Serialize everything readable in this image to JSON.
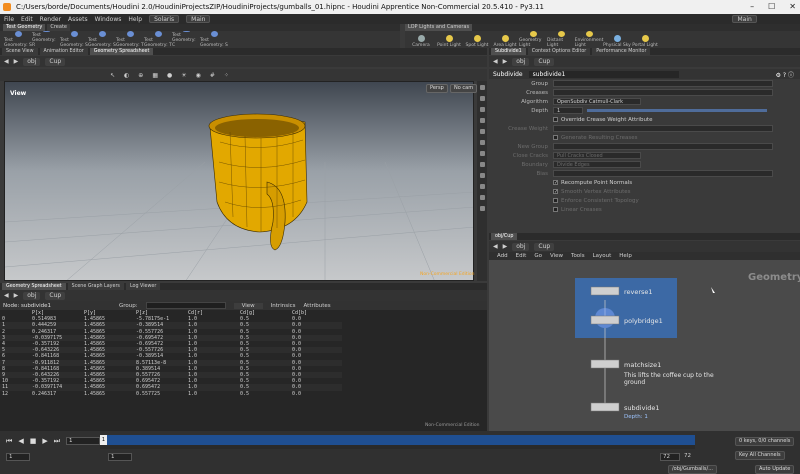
{
  "window": {
    "title": "C:/Users/borde/Documents/Houdini 2.0/HoudiniProjectsZIP/HoudiniProjects/gumballs_01.hipnc - Houdini Apprentice Non-Commercial 20.5.410 - Py3.11"
  },
  "menubar": {
    "items": [
      "File",
      "Edit",
      "Render",
      "Assets",
      "Windows",
      "Help"
    ],
    "desktop": "Solaris",
    "workspace": "Main",
    "right_workspace": "Main"
  },
  "shelf": {
    "tabs": [
      "Test Geometry",
      "Create"
    ],
    "tools": [
      "Test Geometry: S",
      "Test Geometry: R",
      "Test Geometry: S",
      "Test Geometry: S",
      "Test Geometry: T",
      "Test Geometry: T",
      "Test Geometry: C",
      "Test Geometry: S"
    ],
    "right_tab": "LOP Lights and Cameras",
    "right_tools": [
      "Camera",
      "Point Light",
      "Spot Light",
      "Area Light",
      "Geometry Light",
      "Distant Light",
      "Environment Light",
      "Physical Sky",
      "Portal Light"
    ]
  },
  "left_tabs": [
    "Scene View",
    "Animation Editor",
    "Geometry Spreadsheet"
  ],
  "right_tabs": [
    "Subdivide1",
    "Context Options Editor",
    "Performance Monitor"
  ],
  "viewer": {
    "path_root": "obj",
    "path_node": "Cup",
    "label": "View",
    "persp": "Persp",
    "cam": "No cam",
    "watermark": "Non-Commercial Edition"
  },
  "params": {
    "node_type": "Subdivide",
    "node_name": "subdivide1",
    "path_root": "obj",
    "path_node": "Cup",
    "rows": [
      {
        "label": "Group",
        "value": "",
        "dim": false
      },
      {
        "label": "Creases",
        "value": "",
        "dim": false
      },
      {
        "label": "Algorithm",
        "value": "OpenSubdiv Catmull-Clark",
        "dim": false
      },
      {
        "label": "Depth",
        "value": "1",
        "dim": false
      }
    ],
    "checks": [
      {
        "label": "Override Crease Weight Attribute",
        "dim": false
      },
      {
        "label": "Crease Weight",
        "dim": true
      },
      {
        "label": "Generate Resulting Creases",
        "dim": true
      },
      {
        "label": "New Group",
        "dim": true
      },
      {
        "label": "Close Cracks",
        "value": "Pull Cracks Closed",
        "dim": true
      },
      {
        "label": "Boundary",
        "value": "Divide Edges",
        "dim": true
      },
      {
        "label": "Bias",
        "dim": true
      },
      {
        "label": "Recompute Point Normals",
        "dim": false
      },
      {
        "label": "Smooth Vertex Attributes",
        "dim": true
      },
      {
        "label": "Enforce Consistent Topology",
        "dim": true
      },
      {
        "label": "Linear Creases",
        "dim": true
      }
    ]
  },
  "network": {
    "tab": "obj/Cup",
    "path_root": "obj",
    "path_node": "Cup",
    "menu": [
      "Add",
      "Edit",
      "Go",
      "View",
      "Tools",
      "Layout",
      "Help"
    ],
    "context": "Geometry",
    "nodes": [
      {
        "name": "reverse1",
        "comment": "",
        "sub": ""
      },
      {
        "name": "polybridge1",
        "comment": "",
        "sub": ""
      },
      {
        "name": "matchsize1",
        "comment": "This lifts the coffee cup to the ground",
        "sub": ""
      },
      {
        "name": "subdivide1",
        "comment": "",
        "sub": "Depth: 1"
      }
    ]
  },
  "sheet": {
    "tabs": [
      "Geometry Spreadsheet",
      "Scene Graph Layers",
      "Log Viewer"
    ],
    "path_root": "obj",
    "path_node": "Cup",
    "node": "subdivide1",
    "group_label": "Group:",
    "view_label": "View",
    "attr_label": "Intrinsics",
    "attributes_label": "Attributes",
    "columns": [
      "",
      "P[x]",
      "P[y]",
      "P[z]",
      "Cd[r]",
      "Cd[g]",
      "Cd[b]"
    ],
    "rows": [
      [
        "0",
        "0.514983",
        "1.45865",
        "-5.78175e-1",
        "1.0",
        "0.5",
        "0.0"
      ],
      [
        "1",
        "0.444259",
        "1.45865",
        "-0.389514",
        "1.0",
        "0.5",
        "0.0"
      ],
      [
        "2",
        "0.246317",
        "1.45865",
        "-0.557726",
        "1.0",
        "0.5",
        "0.0"
      ],
      [
        "3",
        "-0.0397175",
        "1.45865",
        "-0.695472",
        "1.0",
        "0.5",
        "0.0"
      ],
      [
        "4",
        "-0.357192",
        "1.45865",
        "-0.695472",
        "1.0",
        "0.5",
        "0.0"
      ],
      [
        "5",
        "-0.643226",
        "1.45865",
        "-0.557726",
        "1.0",
        "0.5",
        "0.0"
      ],
      [
        "6",
        "-0.841168",
        "1.45865",
        "-0.389514",
        "1.0",
        "0.5",
        "0.0"
      ],
      [
        "7",
        "-0.911812",
        "1.45865",
        "8.57113e-8",
        "1.0",
        "0.5",
        "0.0"
      ],
      [
        "8",
        "-0.841168",
        "1.45865",
        "0.389514",
        "1.0",
        "0.5",
        "0.0"
      ],
      [
        "9",
        "-0.643226",
        "1.45865",
        "0.557726",
        "1.0",
        "0.5",
        "0.0"
      ],
      [
        "10",
        "-0.357192",
        "1.45865",
        "0.695472",
        "1.0",
        "0.5",
        "0.0"
      ],
      [
        "11",
        "-0.0397174",
        "1.45865",
        "0.695472",
        "1.0",
        "0.5",
        "0.0"
      ],
      [
        "12",
        "0.246317",
        "1.45865",
        "0.557725",
        "1.0",
        "0.5",
        "0.0"
      ]
    ],
    "watermark": "Non-Commercial Edition"
  },
  "timeline": {
    "frame": "1",
    "start": "1",
    "end": "72",
    "end2": "72",
    "range_start": "1",
    "keys": "0 keys, 0/0 channels",
    "key_all": "Key All Channels",
    "auto_update": "Auto Update",
    "obj_path": "/obj/Gumballs/..."
  }
}
